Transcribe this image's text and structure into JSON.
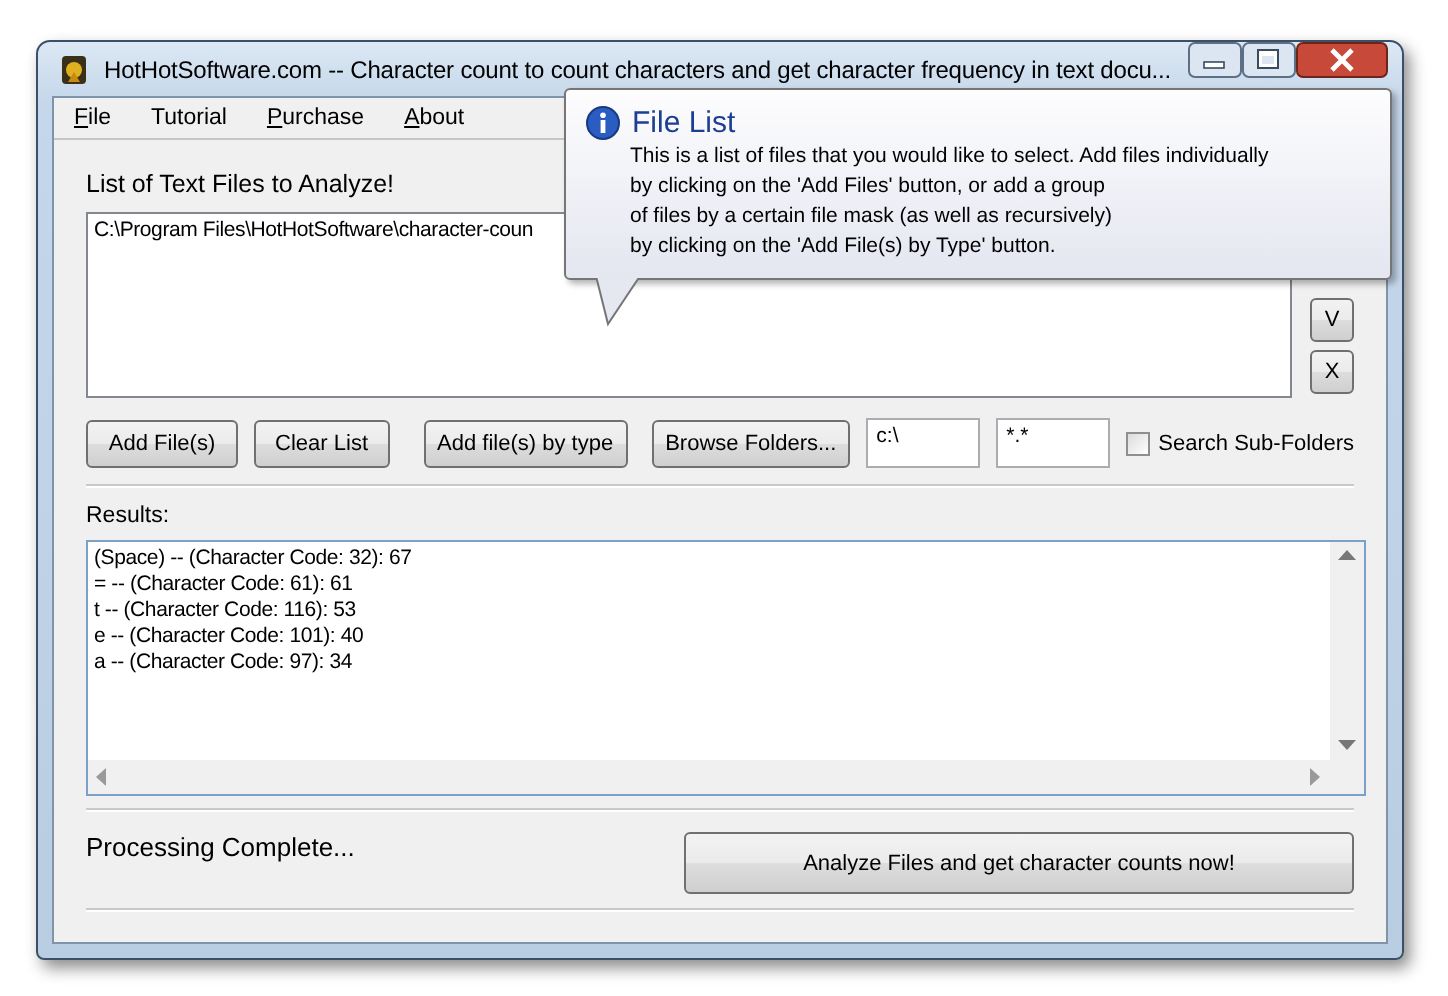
{
  "window": {
    "title": "HotHotSoftware.com -- Character count to count characters and get character frequency in text docu..."
  },
  "menu": [
    {
      "label": "File",
      "mnemonic": true
    },
    {
      "label": "Tutorial",
      "mnemonic": false
    },
    {
      "label": "Purchase",
      "mnemonic": true
    },
    {
      "label": "About",
      "mnemonic": true
    }
  ],
  "file_list": {
    "label": "List of Text Files to Analyze!",
    "items": [
      "C:\\Program Files\\HotHotSoftware\\character-coun"
    ]
  },
  "list_buttons": [
    "V",
    "X"
  ],
  "buttons": [
    "Add File(s)",
    "Clear List",
    "Add file(s) by type",
    "Browse Folders..."
  ],
  "folder_field": {
    "value": "c:\\"
  },
  "mask_field": {
    "value": "*.*"
  },
  "subfolders": {
    "label": "Search Sub-Folders",
    "checked": false
  },
  "results": {
    "label": "Results:",
    "lines": [
      "(Space) -- (Character Code: 32): 67",
      "= -- (Character Code: 61): 61",
      "t -- (Character Code: 116): 53",
      "e -- (Character Code: 101): 40",
      "a -- (Character Code: 97): 34"
    ]
  },
  "status": "Processing Complete...",
  "analyze_button": "Analyze Files and get character counts now!",
  "tooltip": {
    "title": "File List",
    "lines": [
      "This is a list of files that you would like to select. Add files individually",
      "by clicking on the 'Add Files' button, or add a group",
      "of files by a certain file mask (as well as recursively)",
      "by clicking on the 'Add File(s) by Type' button."
    ]
  }
}
